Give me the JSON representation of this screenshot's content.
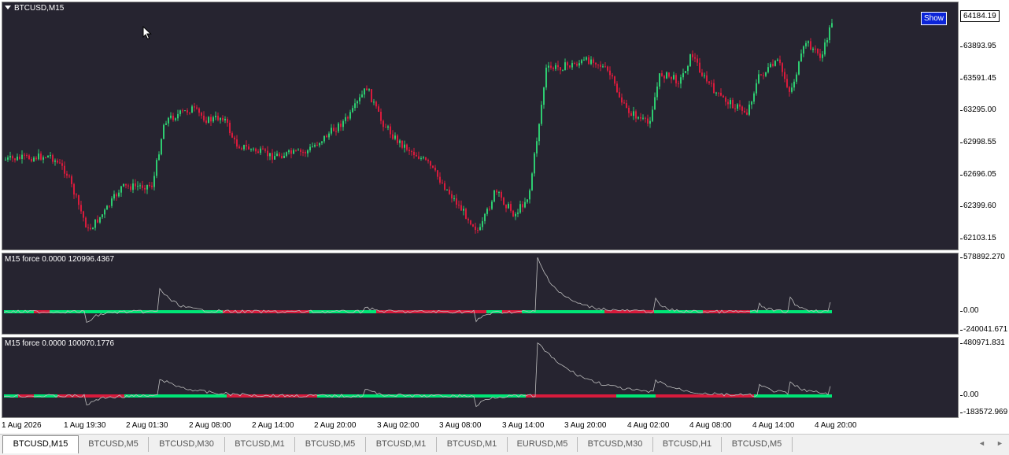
{
  "main_chart": {
    "title": "BTCUSD,M15",
    "show_button": "Show",
    "current_price": "64184.19",
    "price_labels": [
      "63893.95",
      "63591.45",
      "63295.00",
      "62998.55",
      "62696.05",
      "62399.60",
      "62103.15"
    ]
  },
  "indicator1": {
    "title": "M15 force  0.0000 120996.4367",
    "labels": [
      "578892.270",
      "0.00",
      "-240041.671"
    ]
  },
  "indicator2": {
    "title": "M15 force  0.0000 100070.1776",
    "labels": [
      "480971.831",
      "0.00",
      "-183572.969"
    ]
  },
  "time_labels": [
    "1 Aug 2026",
    "1 Aug 19:30",
    "2 Aug 01:30",
    "2 Aug 08:00",
    "2 Aug 14:00",
    "2 Aug 20:00",
    "3 Aug 02:00",
    "3 Aug 08:00",
    "3 Aug 14:00",
    "3 Aug 20:00",
    "4 Aug 02:00",
    "4 Aug 08:00",
    "4 Aug 14:00",
    "4 Aug 20:00"
  ],
  "tabs": [
    "BTCUSD,M15",
    "BTCUSD,M5",
    "BTCUSD,M30",
    "BTCUSD,M1",
    "BTCUSD,M5",
    "BTCUSD,M1",
    "BTCUSD,M1",
    "EURUSD,M5",
    "BTCUSD,M30",
    "BTCUSD,H1",
    "BTCUSD,M5"
  ],
  "nav": {
    "left": "◄",
    "right": "►"
  },
  "colors": {
    "background": "#262430",
    "bull": "#2ecc71",
    "bear": "#d81b3c",
    "force_pos": "#00e676",
    "force_neg": "#d81b3c"
  }
}
